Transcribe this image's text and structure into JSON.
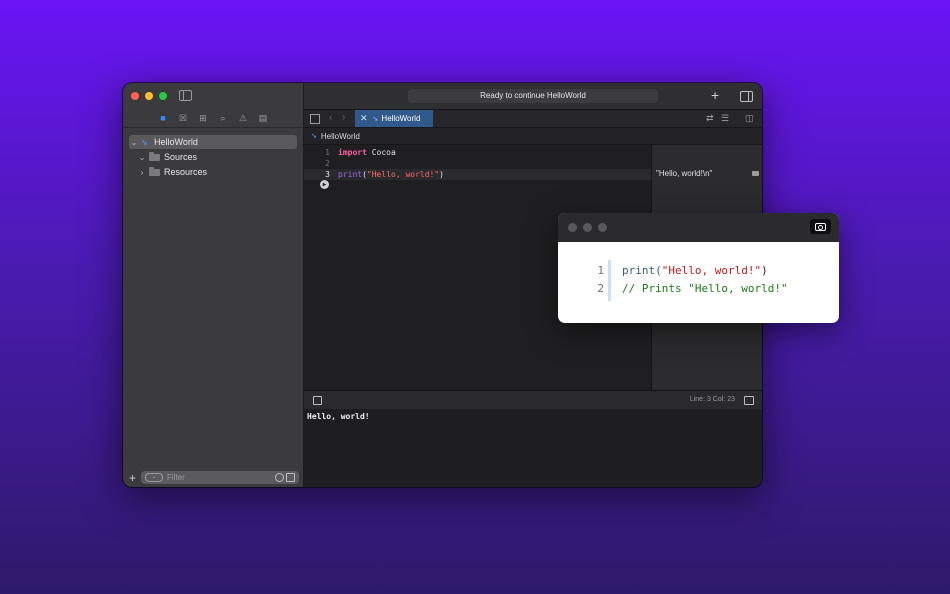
{
  "window": {
    "status": "Ready to continue HelloWorld",
    "sidebar": {
      "tree": [
        {
          "label": "HelloWorld",
          "chevron": "⌄",
          "icon": "swift-icon"
        },
        {
          "label": "Sources",
          "chevron": "⌄",
          "icon": "folder-icon"
        },
        {
          "label": "Resources",
          "chevron": "›",
          "icon": "folder-icon"
        }
      ],
      "filter_placeholder": "Filter",
      "add_label": "+"
    },
    "tab": {
      "label": "HelloWorld"
    },
    "jumpbar": {
      "label": "HelloWorld"
    },
    "editor": {
      "lines": [
        {
          "num": "1",
          "kw": "import",
          "rest": " Cocoa"
        },
        {
          "num": "2"
        },
        {
          "num": "3",
          "fn": "print",
          "open": "(",
          "str": "\"Hello, world!\"",
          "close": ")"
        }
      ]
    },
    "results": {
      "value": "\"Hello, world!\\n\""
    },
    "debug": {
      "linecol": "Line: 3  Col: 23"
    },
    "console": {
      "output": "Hello, world!"
    }
  },
  "popup": {
    "lines": [
      {
        "num": "1",
        "fn": "print(",
        "str": "\"Hello, world!\"",
        "close": ")"
      },
      {
        "num": "2",
        "comment": "// Prints \"Hello, world!\""
      }
    ]
  }
}
